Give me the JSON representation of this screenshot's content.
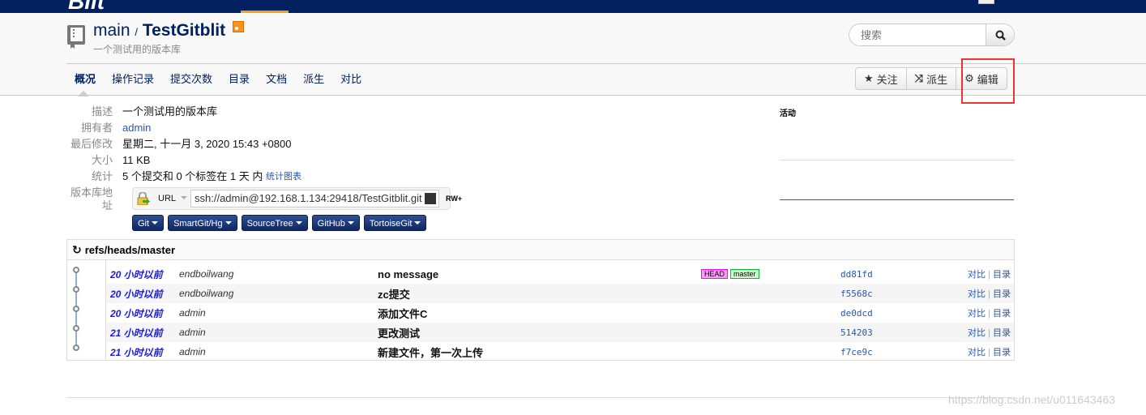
{
  "navbar": {
    "logo": "Blit",
    "accent": "#f7a21b",
    "bg": "#002060"
  },
  "header": {
    "project": "main",
    "separator": "/",
    "repo": "TestGitblit",
    "description": "一个测试用的版本库",
    "search_placeholder": "搜索"
  },
  "tabs": [
    {
      "label": "概况",
      "active": true
    },
    {
      "label": "操作记录"
    },
    {
      "label": "提交次数"
    },
    {
      "label": "目录"
    },
    {
      "label": "文档"
    },
    {
      "label": "派生"
    },
    {
      "label": "对比"
    }
  ],
  "actions": [
    {
      "label": "关注",
      "icon": "star-icon"
    },
    {
      "label": "派生",
      "icon": "fork-icon"
    },
    {
      "label": "编辑",
      "icon": "gear-icon"
    }
  ],
  "props": {
    "desc_label": "描述",
    "desc": "一个测试用的版本库",
    "owner_label": "拥有者",
    "owner": "admin",
    "modified_label": "最后修改",
    "modified": "星期二, 十一月 3, 2020 15:43 +0800",
    "size_label": "大小",
    "size": "11 KB",
    "stats_label": "统计",
    "stats": "5 个提交和 0 个标签在 1 天 内",
    "stats_link": "统计图表",
    "url_label": "版本库地址"
  },
  "url": {
    "protocol": "URL",
    "value": "ssh://admin@192.168.1.134:29418/TestGitblit.git",
    "permission": "RW+"
  },
  "clients": [
    "Git",
    "SmartGit/Hg",
    "SourceTree",
    "GitHub",
    "TortoiseGit"
  ],
  "activity": {
    "title": "活动"
  },
  "commits": {
    "branch": "refs/heads/master",
    "compare_label": "对比",
    "tree_label": "目录",
    "rows": [
      {
        "date": "20 小时以前",
        "author": "endboilwang",
        "message": "no message",
        "hash": "dd81fd",
        "refs": [
          {
            "name": "HEAD",
            "bg": "#ff99ff",
            "border": "#ff00ff"
          },
          {
            "name": "master",
            "bg": "#ccffcc",
            "border": "#00bb33"
          }
        ]
      },
      {
        "date": "20 小时以前",
        "author": "endboilwang",
        "message": "zc提交",
        "hash": "f5568c",
        "refs": []
      },
      {
        "date": "20 小时以前",
        "author": "admin",
        "message": "添加文件C",
        "hash": "de0dcd",
        "refs": []
      },
      {
        "date": "21 小时以前",
        "author": "admin",
        "message": "更改测试",
        "hash": "514203",
        "refs": []
      },
      {
        "date": "21 小时以前",
        "author": "admin",
        "message": "新建文件，第一次上传",
        "hash": "f7ce9c",
        "refs": []
      }
    ]
  },
  "watermark": "https://blog.csdn.net/u011643463"
}
